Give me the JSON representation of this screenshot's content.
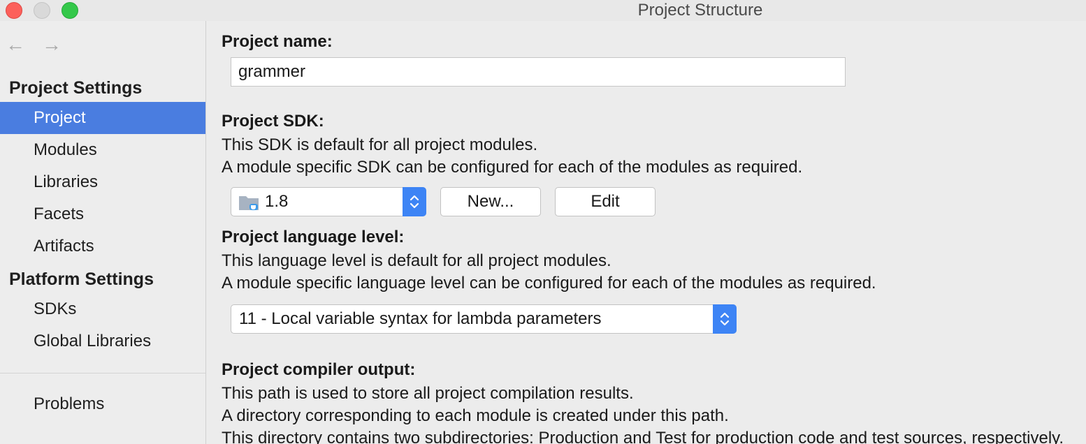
{
  "window": {
    "title": "Project Structure"
  },
  "sidebar": {
    "back_icon": "←",
    "forward_icon": "→",
    "project_settings_header": "Project Settings",
    "project_items": [
      {
        "label": "Project",
        "selected": true
      },
      {
        "label": "Modules"
      },
      {
        "label": "Libraries"
      },
      {
        "label": "Facets"
      },
      {
        "label": "Artifacts"
      }
    ],
    "platform_settings_header": "Platform Settings",
    "platform_items": [
      {
        "label": "SDKs"
      },
      {
        "label": "Global Libraries"
      }
    ],
    "problems_label": "Problems",
    "selected_color": "#4a7de0"
  },
  "main": {
    "project_name": {
      "label": "Project name:",
      "value": "grammer"
    },
    "project_sdk": {
      "label": "Project SDK:",
      "desc1": "This SDK is default for all project modules.",
      "desc2": "A module specific SDK can be configured for each of the modules as required.",
      "selected": "1.8",
      "new_button": "New...",
      "edit_button": "Edit"
    },
    "language_level": {
      "label": "Project language level:",
      "desc1": "This language level is default for all project modules.",
      "desc2": "A module specific language level can be configured for each of the modules as required.",
      "selected": "11 - Local variable syntax for lambda parameters"
    },
    "compiler_output": {
      "label": "Project compiler output:",
      "desc1": "This path is used to store all project compilation results.",
      "desc2": "A directory corresponding to each module is created under this path.",
      "desc3": "This directory contains two subdirectories: Production and Test for production code and test sources, respectively."
    }
  },
  "colors": {
    "accent": "#3d84f5"
  }
}
